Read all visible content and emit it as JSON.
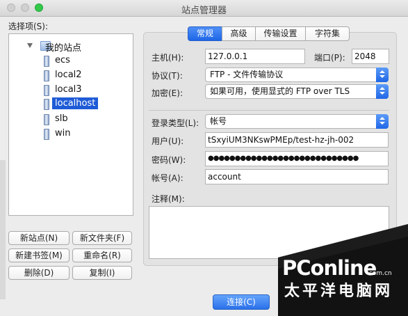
{
  "window": {
    "title": "站点管理器"
  },
  "sidebar": {
    "label": "选择项(S):",
    "root": "我的站点",
    "items": [
      {
        "label": "ecs",
        "selected": false
      },
      {
        "label": "local2",
        "selected": false
      },
      {
        "label": "local3",
        "selected": false
      },
      {
        "label": "localhost",
        "selected": true
      },
      {
        "label": "slb",
        "selected": false
      },
      {
        "label": "win",
        "selected": false
      }
    ]
  },
  "buttons": {
    "new_site": "新站点(N)",
    "new_folder": "新文件夹(F)",
    "new_bookmark": "新建书签(M)",
    "rename": "重命名(R)",
    "delete": "删除(D)",
    "copy": "复制(I)",
    "connect": "连接(C)"
  },
  "tabs": [
    {
      "label": "常规",
      "active": true
    },
    {
      "label": "高级",
      "active": false
    },
    {
      "label": "传输设置",
      "active": false
    },
    {
      "label": "字符集",
      "active": false
    }
  ],
  "form": {
    "host_label": "主机(H):",
    "host_value": "127.0.0.1",
    "port_label": "端口(P):",
    "port_value": "2048",
    "protocol_label": "协议(T):",
    "protocol_value": "FTP - 文件传输协议",
    "encryption_label": "加密(E):",
    "encryption_value": "如果可用，使用显式的 FTP over TLS",
    "login_type_label": "登录类型(L):",
    "login_type_value": "帐号",
    "user_label": "用户(U):",
    "user_value": "tSxyiUM3NKswPMEp/test-hz-jh-002",
    "password_label": "密码(W):",
    "password_value": "●●●●●●●●●●●●●●●●●●●●●●●●●●●●",
    "account_label": "帐号(A):",
    "account_value": "account",
    "notes_label": "注释(M):"
  },
  "watermark": {
    "brand": "PConline",
    "domain": ".com.cn",
    "sub": "太平洋电脑网"
  },
  "colors": {
    "accent": "#1f66e6",
    "selection": "#1f5bd6",
    "watermark_bg": "#111111"
  }
}
